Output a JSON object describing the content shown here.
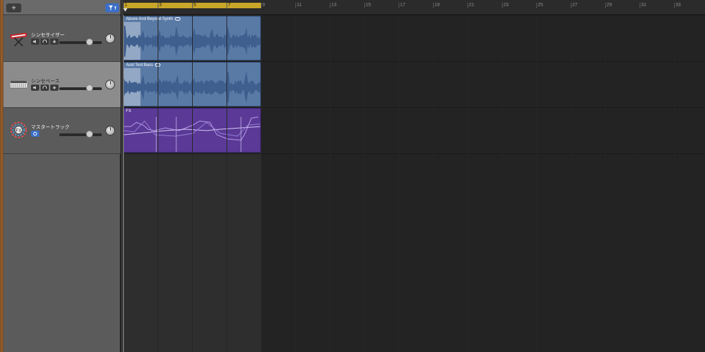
{
  "header": {
    "add_label": "+",
    "filter_icon": "filter-icon"
  },
  "tracks": [
    {
      "name": "シンセサイザー",
      "icon": "synth-keyboard-icon",
      "selected": false,
      "volume": 0.8,
      "buttons": [
        "mute-icon",
        "headphones-icon",
        "record-enable-icon"
      ]
    },
    {
      "name": "シンセベース",
      "icon": "bass-synth-icon",
      "selected": true,
      "volume": 0.8,
      "buttons": [
        "mute-icon",
        "headphones-icon",
        "record-enable-icon"
      ]
    },
    {
      "name": "マスタートラック",
      "icon": "fx-master-icon",
      "selected": false,
      "volume": 0.8,
      "buttons": [
        "automation-icon"
      ]
    }
  ],
  "ruler": {
    "bars": [
      "1",
      "3",
      "5",
      "7",
      "9",
      "11",
      "13",
      "15",
      "17",
      "19",
      "21",
      "23",
      "25",
      "27",
      "29",
      "31",
      "33"
    ]
  },
  "regions": [
    {
      "title": "Above And Beyond Synth",
      "type": "audio"
    },
    {
      "title": "Acid Test Bass",
      "type": "audio"
    },
    {
      "title": "FX",
      "type": "fx"
    }
  ],
  "colors": {
    "cycle": "#c9a62a",
    "audio_region": "#5a7aa6",
    "fx_region": "#5a3a96",
    "accent_blue": "#3b6fc8"
  }
}
